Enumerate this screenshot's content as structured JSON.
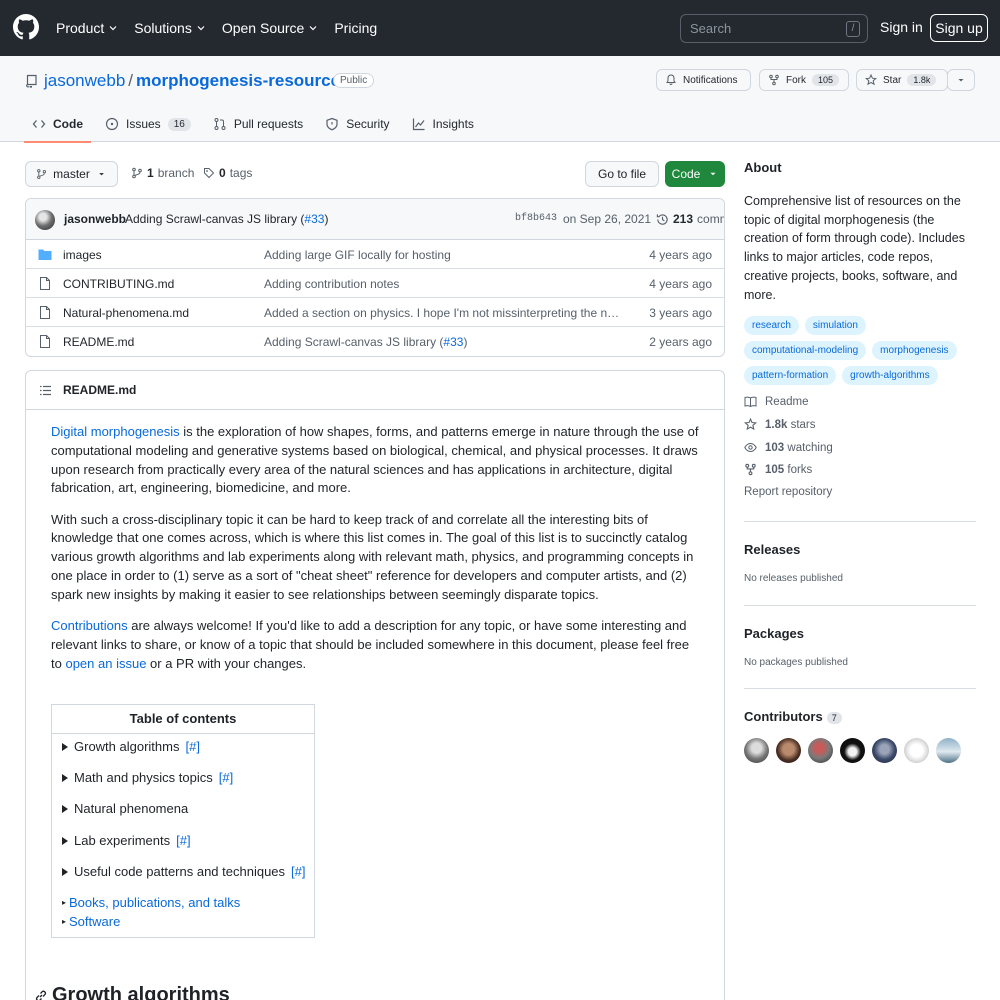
{
  "header": {
    "nav": [
      "Product",
      "Solutions",
      "Open Source",
      "Pricing"
    ],
    "search_placeholder": "Search",
    "search_shortcut": "/",
    "signin": "Sign in",
    "signup": "Sign up"
  },
  "repo": {
    "owner": "jasonwebb",
    "separator": "/",
    "name": "morphogenesis-resources",
    "visibility": "Public",
    "notifications": "Notifications",
    "fork_label": "Fork",
    "fork_count": "105",
    "star_label": "Star",
    "star_count": "1.8k"
  },
  "tabs": [
    {
      "label": "Code",
      "icon": "code-icon"
    },
    {
      "label": "Issues",
      "count": "16",
      "icon": "issue-icon"
    },
    {
      "label": "Pull requests",
      "icon": "pull-request-icon"
    },
    {
      "label": "Security",
      "icon": "shield-icon"
    },
    {
      "label": "Insights",
      "icon": "graph-icon"
    }
  ],
  "toolbar": {
    "branch": "master",
    "branches_count": "1",
    "branches_label": "branch",
    "tags_count": "0",
    "tags_label": "tags",
    "goto": "Go to file",
    "code": "Code"
  },
  "commit": {
    "author": "jasonwebb",
    "message_pre": "Adding Scrawl-canvas JS library (",
    "message_link": "#33",
    "message_post": ")",
    "sha": "bf8b643",
    "date": "on Sep 26, 2021",
    "commits_count": "213",
    "commits_label": "commits"
  },
  "files": [
    {
      "name": "images",
      "type": "folder",
      "message": "Adding large GIF locally for hosting",
      "age": "4 years ago"
    },
    {
      "name": "CONTRIBUTING.md",
      "type": "file",
      "message": "Adding contribution notes",
      "age": "4 years ago"
    },
    {
      "name": "Natural-phenomena.md",
      "type": "file",
      "message": "Added a section on physics. I hope I'm not missinterpreting the natur…",
      "age": "3 years ago"
    },
    {
      "name": "README.md",
      "type": "file",
      "message_pre": "Adding Scrawl-canvas JS library (",
      "message_link": "#33",
      "message_post": ")",
      "age": "2 years ago"
    }
  ],
  "readme": {
    "title": "README.md",
    "p1_link": "Digital morphogenesis",
    "p1_text": " is the exploration of how shapes, forms, and patterns emerge in nature through the use of computational modeling and generative systems based on biological, chemical, and physical processes. It draws upon research from practically every area of the natural sciences and has applications in architecture, digital fabrication, art, engineering, biomedicine, and more.",
    "p2_text": "With such a cross-disciplinary topic it can be hard to keep track of and correlate all the interesting bits of knowledge that one comes across, which is where this list comes in. The goal of this list is to succinctly catalog various growth algorithms and lab experiments along with relevant math, physics, and programming concepts in one place in order to (1) serve as a sort of \"cheat sheet\" reference for developers and computer artists, and (2) spark new insights by making it easier to see relationships between seemingly disparate topics.",
    "p3_link": "Contributions",
    "p3_text": " are always welcome! If you'd like to add a description for any topic, or have some interesting and relevant links to share, or know of a topic that should be included somewhere in this document, please feel free to ",
    "p3_link2": "open an issue",
    "p3_text2": " or a PR with your changes.",
    "toc_title": "Table of contents",
    "toc_items": [
      {
        "label": "Growth algorithms",
        "anchor": "[#]"
      },
      {
        "label": "Math and physics topics",
        "anchor": "[#]"
      },
      {
        "label": "Natural phenomena",
        "anchor": ""
      },
      {
        "label": "Lab experiments",
        "anchor": "[#]"
      },
      {
        "label": "Useful code patterns and techniques",
        "anchor": "[#]"
      }
    ],
    "toc_links": [
      "Books, publications, and talks",
      "Software"
    ],
    "heading": "Growth algorithms"
  },
  "sidebar": {
    "about_title": "About",
    "about_text": "Comprehensive list of resources on the topic of digital morphogenesis (the creation of form through code). Includes links to major articles, code repos, creative projects, books, software, and more.",
    "topics": [
      "research",
      "simulation",
      "computational-modeling",
      "morphogenesis",
      "pattern-formation",
      "growth-algorithms"
    ],
    "readme": "Readme",
    "stars_count": "1.8k",
    "stars_label": "stars",
    "watching_count": "103",
    "watching_label": "watching",
    "forks_count": "105",
    "forks_label": "forks",
    "report": "Report repository",
    "releases_title": "Releases",
    "releases_text": "No releases published",
    "packages_title": "Packages",
    "packages_text": "No packages published",
    "contributors_title": "Contributors",
    "contributors_count": "7"
  },
  "colors": {
    "header_bg": "#24292f",
    "link": "#0969da",
    "code_button": "#1f883d",
    "active_tab": "#fd8c73",
    "topic_bg": "#ddf4ff"
  }
}
